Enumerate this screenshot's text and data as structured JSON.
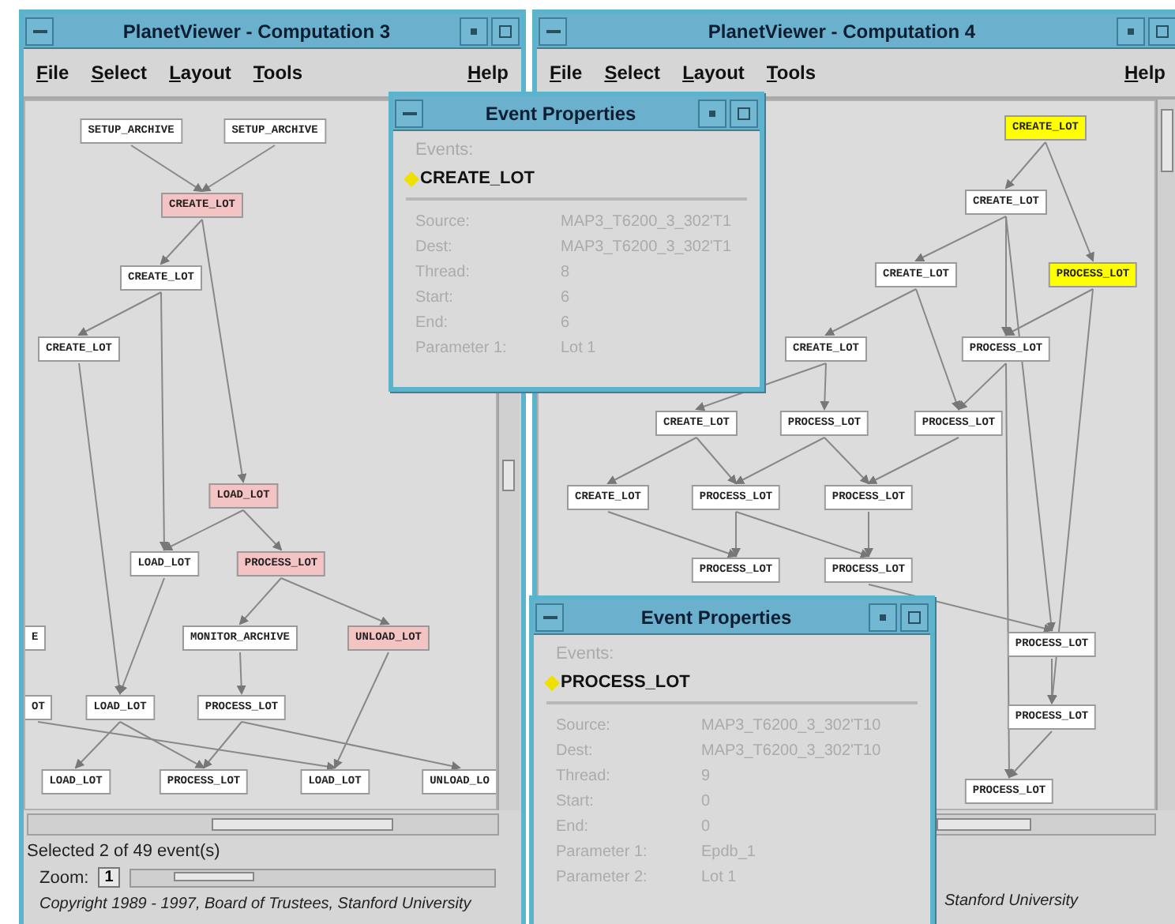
{
  "windows": [
    {
      "title": "PlanetViewer - Computation 3",
      "menu": [
        "File",
        "Select",
        "Layout",
        "Tools",
        "Help"
      ],
      "nodes": [
        {
          "label": "SETUP_ARCHIVE",
          "color": "#ffffff"
        },
        {
          "label": "SETUP_ARCHIVE",
          "color": "#ffffff"
        },
        {
          "label": "CREATE_LOT",
          "color": "#f4c4c4"
        },
        {
          "label": "CREATE_LOT",
          "color": "#ffffff"
        },
        {
          "label": "CREATE_LOT",
          "color": "#ffffff"
        },
        {
          "label": "LOAD_LOT",
          "color": "#f4c4c4"
        },
        {
          "label": "LOAD_LOT",
          "color": "#ffffff"
        },
        {
          "label": "PROCESS_LOT",
          "color": "#f4c4c4"
        },
        {
          "label": "MONITOR_ARCHIVE",
          "color": "#ffffff"
        },
        {
          "label": "UNLOAD_LOT",
          "color": "#f4c4c4"
        },
        {
          "label": "LOAD_LOT",
          "color": "#ffffff"
        },
        {
          "label": "PROCESS_LOT",
          "color": "#ffffff"
        },
        {
          "label": "LOAD_LOT",
          "color": "#ffffff"
        },
        {
          "label": "PROCESS_LOT",
          "color": "#ffffff"
        },
        {
          "label": "LOAD_LOT",
          "color": "#ffffff"
        },
        {
          "label": "UNLOAD_LO",
          "color": "#ffffff"
        },
        {
          "label": "E",
          "color": "#ffffff"
        },
        {
          "label": "OT",
          "color": "#ffffff"
        }
      ],
      "status": "Selected 2 of 49 event(s)",
      "zoom": {
        "label": "Zoom:",
        "value": "1",
        "level": 0.12
      },
      "copyright": "Copyright 1989 - 1997, Board of Trustees, Stanford University"
    },
    {
      "title": "PlanetViewer - Computation 4",
      "menu": [
        "File",
        "Select",
        "Layout",
        "Tools",
        "Help"
      ],
      "nodes": [
        {
          "label": "CREATE_LOT",
          "color": "#ffff00"
        },
        {
          "label": "CREATE_LOT",
          "color": "#ffffff"
        },
        {
          "label": "CREATE_LOT",
          "color": "#ffffff"
        },
        {
          "label": "PROCESS_LOT",
          "color": "#ffff00"
        },
        {
          "label": "CREATE_LOT",
          "color": "#ffffff"
        },
        {
          "label": "PROCESS_LOT",
          "color": "#ffffff"
        },
        {
          "label": "CREATE_LOT",
          "color": "#ffffff"
        },
        {
          "label": "PROCESS_LOT",
          "color": "#ffffff"
        },
        {
          "label": "PROCESS_LOT",
          "color": "#ffffff"
        },
        {
          "label": "CREATE_LOT",
          "color": "#ffffff"
        },
        {
          "label": "PROCESS_LOT",
          "color": "#ffffff"
        },
        {
          "label": "PROCESS_LOT",
          "color": "#ffffff"
        },
        {
          "label": "PROCESS_LOT",
          "color": "#ffffff"
        },
        {
          "label": "PROCESS_LOT",
          "color": "#ffffff"
        },
        {
          "label": "PROCESS_LOT",
          "color": "#ffffff"
        },
        {
          "label": "PROCESS_LOT",
          "color": "#ffffff"
        },
        {
          "label": "PROCESS_LOT",
          "color": "#ffffff"
        }
      ],
      "copyright": "Stanford University"
    }
  ],
  "dialogs": [
    {
      "title": "Event Properties",
      "events_label": "Events:",
      "events": [
        {
          "name": "CREATE_LOT",
          "selected": true
        }
      ],
      "properties": [
        {
          "label": "Source:",
          "value": "MAP3_T6200_3_302'T1"
        },
        {
          "label": "Dest:",
          "value": "MAP3_T6200_3_302'T1"
        },
        {
          "label": "Thread:",
          "value": "8"
        },
        {
          "label": "Start:",
          "value": "6"
        },
        {
          "label": "End:",
          "value": "6"
        },
        {
          "label": "Parameter 1:",
          "value": "Lot 1"
        }
      ]
    },
    {
      "title": "Event Properties",
      "events_label": "Events:",
      "events": [
        {
          "name": "PROCESS_LOT",
          "selected": true
        }
      ],
      "properties": [
        {
          "label": "Source:",
          "value": "MAP3_T6200_3_302'T10"
        },
        {
          "label": "Dest:",
          "value": "MAP3_T6200_3_302'T10"
        },
        {
          "label": "Thread:",
          "value": "9"
        },
        {
          "label": "Start:",
          "value": "0"
        },
        {
          "label": "End:",
          "value": "0"
        },
        {
          "label": "Parameter 1:",
          "value": "Epdb_1"
        },
        {
          "label": "Parameter 2:",
          "value": "Lot 1"
        }
      ]
    }
  ]
}
